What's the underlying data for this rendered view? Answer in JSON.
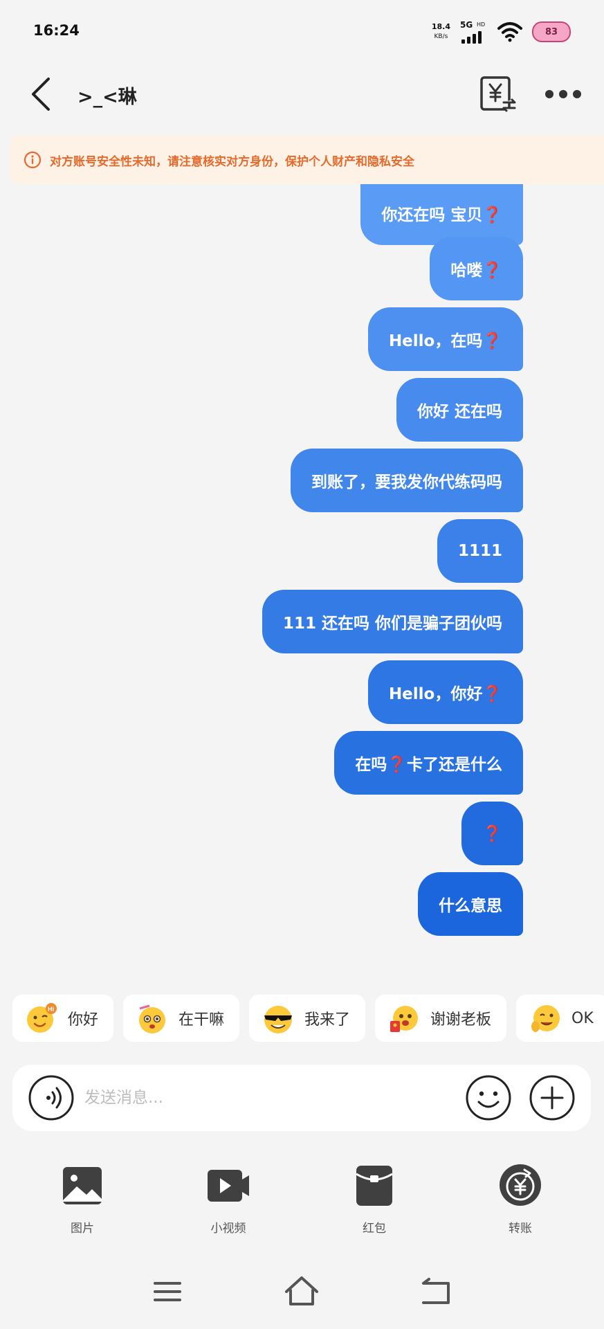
{
  "status_bar": {
    "time": "16:24",
    "net_speed": "18.4",
    "net_speed_unit": "KB/s",
    "network": "5G",
    "hd": "HD",
    "battery": "83"
  },
  "header": {
    "title": ">_<琳",
    "back_icon": "chevron-left-icon",
    "transfer_icon": "yuan-transfer-icon",
    "more_icon": "more-dots-icon"
  },
  "safety_banner": {
    "text": "对方账号安全性未知，请注意核实对方身份，保护个人财产和隐私安全",
    "color": "#e46a2c"
  },
  "messages": [
    {
      "text": "你还在吗 宝贝❓",
      "sender": "me"
    },
    {
      "text": "哈喽❓",
      "sender": "me"
    },
    {
      "text": "Hello，在吗❓",
      "sender": "me"
    },
    {
      "text": "你好 还在吗",
      "sender": "me"
    },
    {
      "text": "到账了，要我发你代练码吗",
      "sender": "me"
    },
    {
      "text": "1111",
      "sender": "me"
    },
    {
      "text": "111 还在吗 你们是骗子团伙吗",
      "sender": "me"
    },
    {
      "text": "Hello，你好❓",
      "sender": "me"
    },
    {
      "text": "在吗❓卡了还是什么",
      "sender": "me"
    },
    {
      "text": "❓",
      "sender": "me"
    },
    {
      "text": "什么意思",
      "sender": "me"
    }
  ],
  "quick_replies": [
    {
      "label": "你好",
      "icon": "hi-emoji-icon"
    },
    {
      "label": "在干嘛",
      "icon": "curious-emoji-icon"
    },
    {
      "label": "我来了",
      "icon": "sunglasses-emoji-icon"
    },
    {
      "label": "谢谢老板",
      "icon": "red-envelope-emoji-icon"
    },
    {
      "label": "OK",
      "icon": "wink-emoji-icon"
    }
  ],
  "input": {
    "placeholder": "发送消息...",
    "value": ""
  },
  "toolbar": [
    {
      "label": "图片",
      "icon": "image-icon"
    },
    {
      "label": "小视频",
      "icon": "video-icon"
    },
    {
      "label": "红包",
      "icon": "red-packet-icon"
    },
    {
      "label": "转账",
      "icon": "transfer-icon"
    }
  ],
  "colors": {
    "bubble_top": "#5a9bf5",
    "bubble_bottom": "#1b66dc",
    "background": "#f4f4f4"
  }
}
